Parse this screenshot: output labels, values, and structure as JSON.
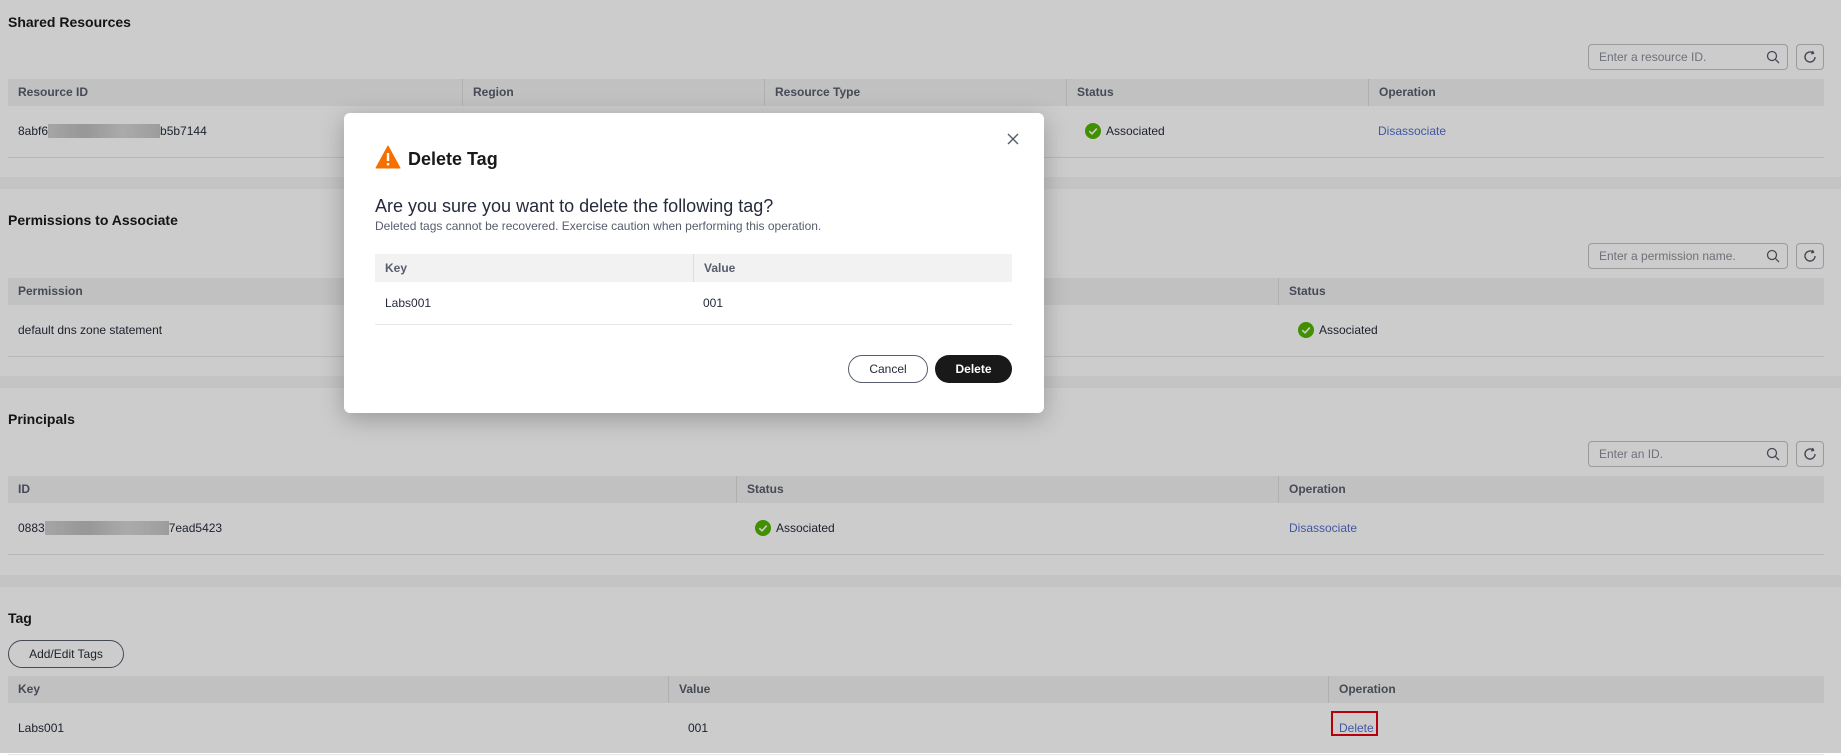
{
  "shared_resources": {
    "title": "Shared Resources",
    "search_placeholder": "Enter a resource ID.",
    "columns": [
      "Resource ID",
      "Region",
      "Resource Type",
      "Status",
      "Operation"
    ],
    "row": {
      "id_prefix": "8abf6",
      "id_suffix": "b5b7144",
      "status": "Associated",
      "operation": "Disassociate"
    }
  },
  "permissions": {
    "title": "Permissions to Associate",
    "search_placeholder": "Enter a permission name.",
    "columns": [
      "Permission",
      "Status"
    ],
    "row": {
      "permission": "default dns zone statement",
      "status": "Associated"
    }
  },
  "principals": {
    "title": "Principals",
    "search_placeholder": "Enter an ID.",
    "columns": [
      "ID",
      "Status",
      "Operation"
    ],
    "row": {
      "id_prefix": "0883",
      "id_suffix": "7ead5423",
      "status": "Associated",
      "operation": "Disassociate"
    }
  },
  "tags": {
    "title": "Tag",
    "add_edit_label": "Add/Edit Tags",
    "columns": [
      "Key",
      "Value",
      "Operation"
    ],
    "row": {
      "key": "Labs001",
      "value": "001",
      "operation": "Delete"
    }
  },
  "dialog": {
    "title": "Delete Tag",
    "question": "Are you sure you want to delete the following tag?",
    "subtext": "Deleted tags cannot be recovered. Exercise caution when performing this operation.",
    "columns": [
      "Key",
      "Value"
    ],
    "row": {
      "key": "Labs001",
      "value": "001"
    },
    "cancel_label": "Cancel",
    "delete_label": "Delete"
  },
  "colors": {
    "link": "#526ecc",
    "success": "#50b400",
    "warning": "#f66f00",
    "highlight": "#e4000f",
    "primary_button": "#191919"
  },
  "icons": [
    "search-icon",
    "refresh-icon",
    "check-circle-icon",
    "warning-icon",
    "close-icon"
  ]
}
